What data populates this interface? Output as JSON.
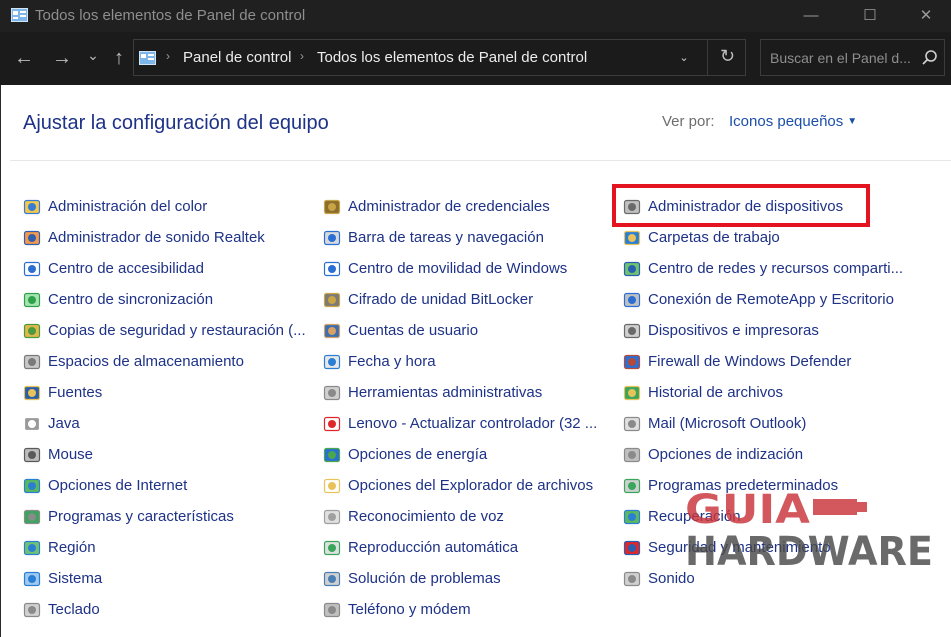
{
  "window": {
    "title": "Todos los elementos de Panel de control",
    "minimize_glyph": "—",
    "maximize_glyph": "☐",
    "close_glyph": "✕"
  },
  "toolbar": {
    "back_glyph": "←",
    "forward_glyph": "→",
    "recent_glyph": "⌄",
    "up_glyph": "↑",
    "refresh_glyph": "↻",
    "address_dropdown_glyph": "⌄",
    "breadcrumbs": [
      "Panel de control",
      "Todos los elementos de Panel de control"
    ],
    "breadcrumb_separator": "›",
    "search_placeholder": "Buscar en el Panel d..."
  },
  "main": {
    "heading": "Ajustar la configuración del equipo",
    "view_by_label": "Ver por:",
    "view_by_value": "Iconos pequeños"
  },
  "columns": [
    {
      "items": [
        {
          "label": "Administración del color",
          "icon": "color-management-icon"
        },
        {
          "label": "Administrador de sonido Realtek",
          "icon": "realtek-audio-icon"
        },
        {
          "label": "Centro de accesibilidad",
          "icon": "accessibility-icon"
        },
        {
          "label": "Centro de sincronización",
          "icon": "sync-center-icon"
        },
        {
          "label": "Copias de seguridad y restauración (...",
          "icon": "backup-restore-icon"
        },
        {
          "label": "Espacios de almacenamiento",
          "icon": "storage-spaces-icon"
        },
        {
          "label": "Fuentes",
          "icon": "fonts-folder-icon"
        },
        {
          "label": "Java",
          "icon": "java-document-icon"
        },
        {
          "label": "Mouse",
          "icon": "mouse-icon"
        },
        {
          "label": "Opciones de Internet",
          "icon": "internet-options-icon"
        },
        {
          "label": "Programas y características",
          "icon": "programs-features-icon"
        },
        {
          "label": "Región",
          "icon": "region-globe-icon"
        },
        {
          "label": "Sistema",
          "icon": "system-icon"
        },
        {
          "label": "Teclado",
          "icon": "keyboard-icon"
        }
      ]
    },
    {
      "items": [
        {
          "label": "Administrador de credenciales",
          "icon": "credential-manager-icon"
        },
        {
          "label": "Barra de tareas y navegación",
          "icon": "taskbar-icon"
        },
        {
          "label": "Centro de movilidad de Windows",
          "icon": "mobility-center-icon"
        },
        {
          "label": "Cifrado de unidad BitLocker",
          "icon": "bitlocker-key-icon"
        },
        {
          "label": "Cuentas de usuario",
          "icon": "user-accounts-icon"
        },
        {
          "label": "Fecha y hora",
          "icon": "date-time-icon"
        },
        {
          "label": "Herramientas administrativas",
          "icon": "admin-tools-icon"
        },
        {
          "label": "Lenovo - Actualizar controlador (32 ...",
          "icon": "lenovo-update-icon"
        },
        {
          "label": "Opciones de energía",
          "icon": "power-options-icon"
        },
        {
          "label": "Opciones del Explorador de archivos",
          "icon": "explorer-options-icon"
        },
        {
          "label": "Reconocimiento de voz",
          "icon": "microphone-icon"
        },
        {
          "label": "Reproducción automática",
          "icon": "autoplay-icon"
        },
        {
          "label": "Solución de problemas",
          "icon": "troubleshooting-icon"
        },
        {
          "label": "Teléfono y módem",
          "icon": "phone-modem-icon"
        }
      ]
    },
    {
      "items": [
        {
          "label": "Administrador de dispositivos",
          "icon": "device-manager-icon"
        },
        {
          "label": "Carpetas de trabajo",
          "icon": "work-folders-icon"
        },
        {
          "label": "Centro de redes y recursos comparti...",
          "icon": "network-center-icon"
        },
        {
          "label": "Conexión de RemoteApp y Escritorio",
          "icon": "remoteapp-icon"
        },
        {
          "label": "Dispositivos e impresoras",
          "icon": "printer-icon"
        },
        {
          "label": "Firewall de Windows Defender",
          "icon": "firewall-icon"
        },
        {
          "label": "Historial de archivos",
          "icon": "file-history-icon"
        },
        {
          "label": "Mail (Microsoft Outlook)",
          "icon": "mail-icon"
        },
        {
          "label": "Opciones de indización",
          "icon": "indexing-icon"
        },
        {
          "label": "Programas predeterminados",
          "icon": "default-programs-icon"
        },
        {
          "label": "Recuperación",
          "icon": "recovery-icon"
        },
        {
          "label": "Seguridad y mantenimiento",
          "icon": "security-flag-icon"
        },
        {
          "label": "Sonido",
          "icon": "sound-icon"
        }
      ]
    }
  ],
  "watermark": {
    "text": [
      "GUIA",
      "HARDWARE"
    ]
  },
  "colors": {
    "link_blue": "#1e3287",
    "highlight_red": "#e3141f",
    "titlebar_bg": "#202020"
  }
}
